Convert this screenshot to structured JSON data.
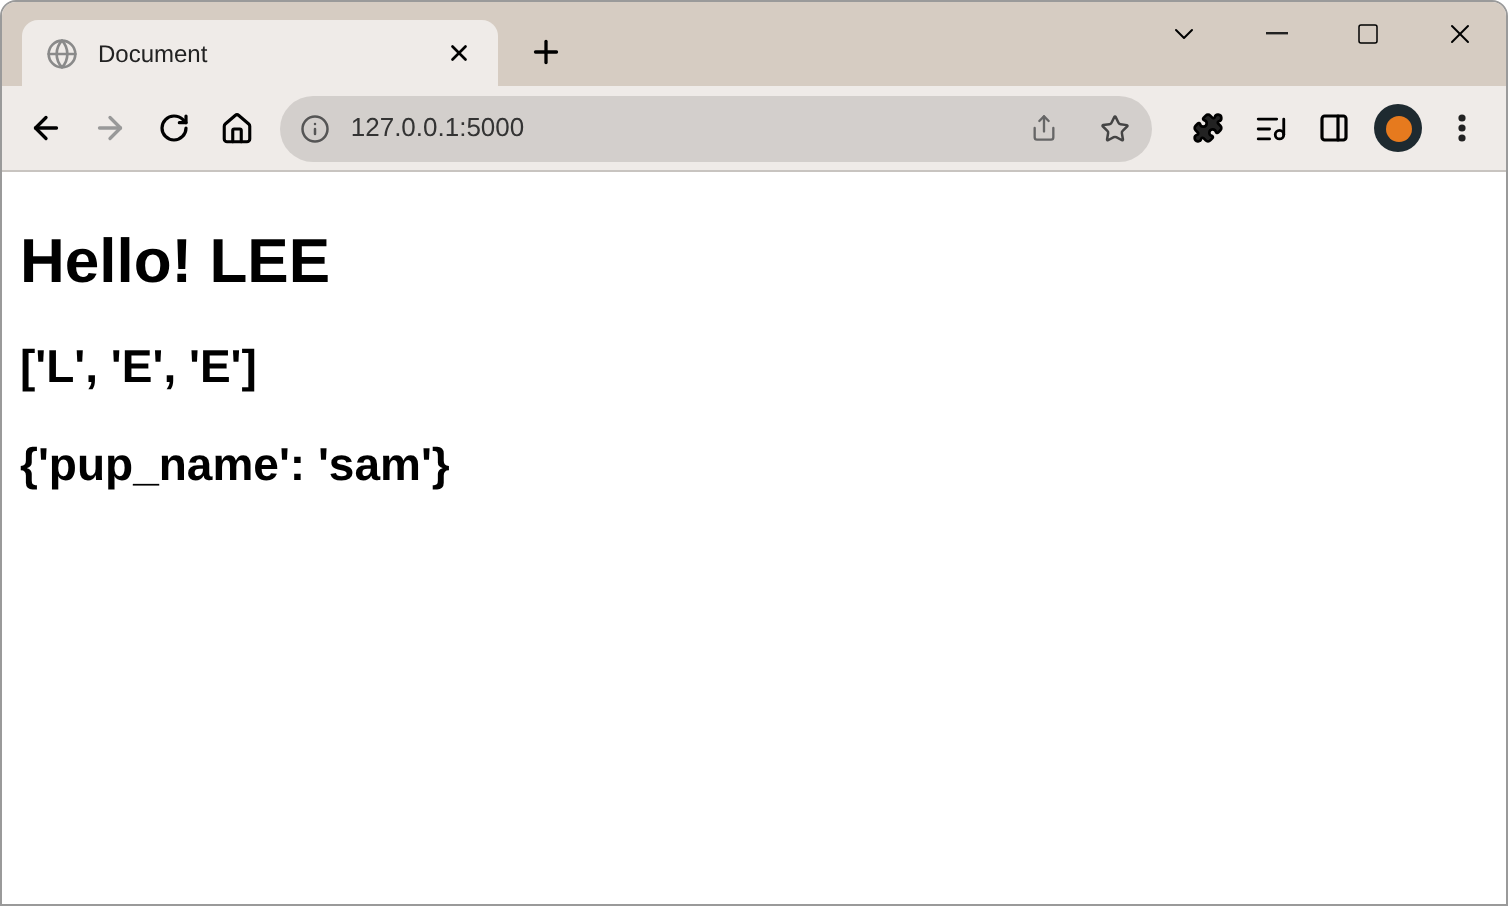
{
  "tab": {
    "title": "Document"
  },
  "address_bar": {
    "url": "127.0.0.1:5000"
  },
  "page": {
    "heading": "Hello! LEE",
    "lines": [
      "['L', 'E', 'E']",
      "{'pup_name': 'sam'}"
    ]
  }
}
